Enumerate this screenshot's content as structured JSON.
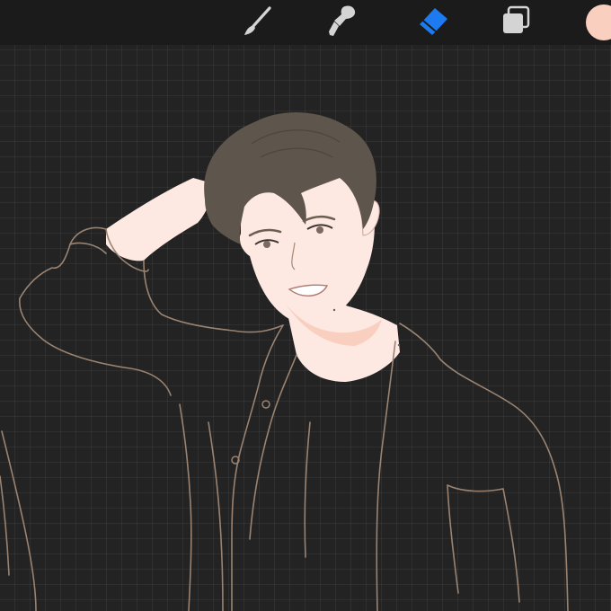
{
  "toolbar": {
    "tools": [
      {
        "name": "brush-icon",
        "active": false
      },
      {
        "name": "smudge-icon",
        "active": false
      },
      {
        "name": "eraser-icon",
        "active": true
      },
      {
        "name": "layers-icon",
        "active": false
      }
    ],
    "current_color": "#f9cfc0"
  },
  "colors": {
    "toolbar_bg": "#1b1b1b",
    "canvas_bg": "#232323",
    "active_tool": "#1d7bf2",
    "inactive_tool": "#d4d4d4",
    "line_art": "#9a8371",
    "hair": "#5e554c",
    "skin": "#fde8e2"
  }
}
